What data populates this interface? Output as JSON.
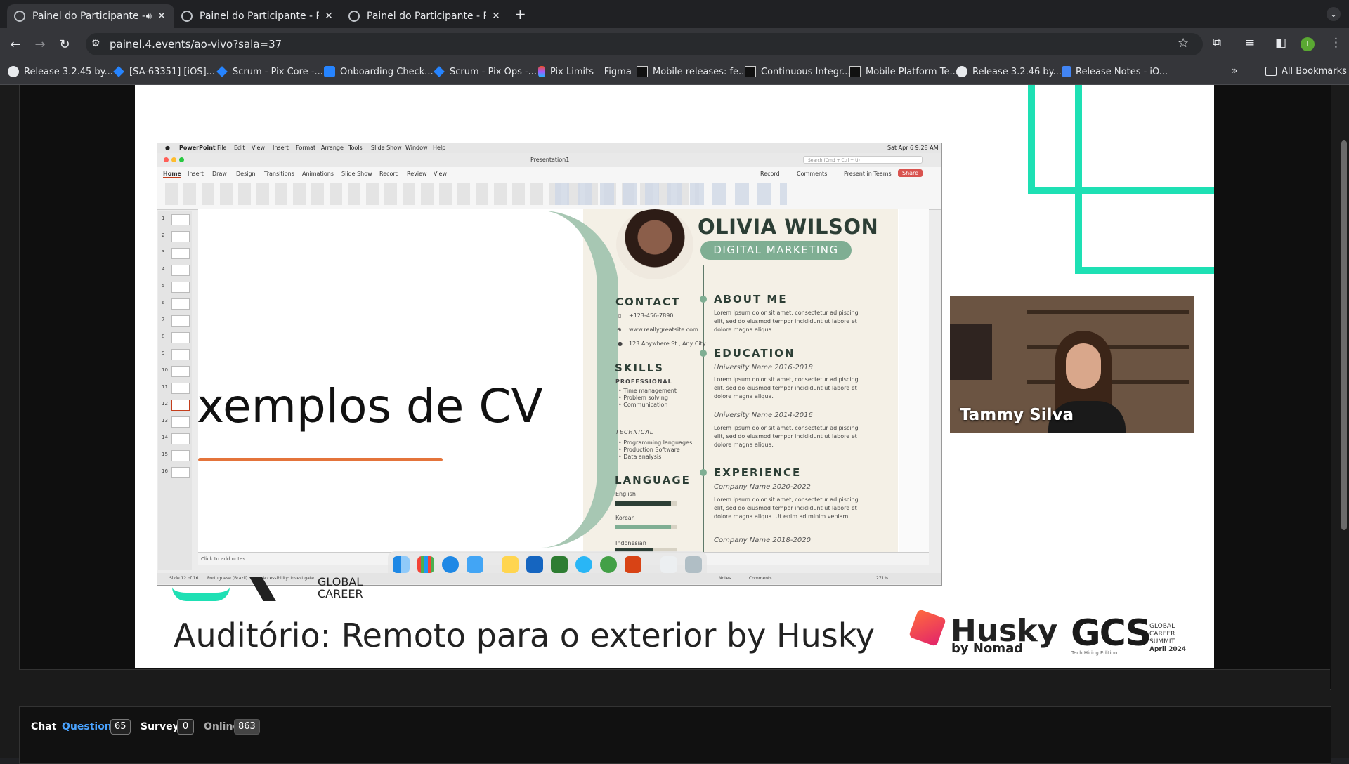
{
  "browser": {
    "tabs": [
      {
        "title": "Painel do Participante - P",
        "active": true,
        "muted_icon": "speaker-icon"
      },
      {
        "title": "Painel do Participante - Powe",
        "active": false
      },
      {
        "title": "Painel do Participante - Powe",
        "active": false
      }
    ],
    "new_tab_label": "+",
    "url": "painel.4.events/ao-vivo?sala=37",
    "profile_initial": "I",
    "bookmarks": [
      {
        "label": "Release 3.2.45 by...",
        "icon": "github-icon"
      },
      {
        "label": "[SA-63351] [iOS]...",
        "icon": "jira-icon"
      },
      {
        "label": "Scrum - Pix Core -...",
        "icon": "jira-icon"
      },
      {
        "label": "Onboarding Check...",
        "icon": "confluence-icon"
      },
      {
        "label": "Scrum - Pix Ops -...",
        "icon": "jira-icon"
      },
      {
        "label": "Pix Limits – Figma",
        "icon": "figma-icon"
      },
      {
        "label": "Mobile releases: fe...",
        "icon": "ci-icon"
      },
      {
        "label": "Continuous Integr...",
        "icon": "ci-icon"
      },
      {
        "label": "Mobile Platform Te...",
        "icon": "ci-icon"
      },
      {
        "label": "Release 3.2.46 by...",
        "icon": "github-icon"
      },
      {
        "label": "Release Notes - iO...",
        "icon": "docs-icon"
      }
    ],
    "all_bookmarks": "All Bookmarks"
  },
  "shared_screen": {
    "mac_menu": [
      "PowerPoint",
      "File",
      "Edit",
      "View",
      "Insert",
      "Format",
      "Arrange",
      "Tools",
      "Slide Show",
      "Window",
      "Help"
    ],
    "clock": "Sat Apr 6  9:28 AM",
    "doc_title": "Presentation1",
    "search_placeholder": "Search (Cmd + Ctrl + U)",
    "ribbon_tabs": [
      "Home",
      "Insert",
      "Draw",
      "Design",
      "Transitions",
      "Animations",
      "Slide Show",
      "Record",
      "Review",
      "View"
    ],
    "ribbon_actions": [
      "Record",
      "Comments",
      "Present in Teams",
      "Share"
    ],
    "slide_numbers": [
      "1",
      "2",
      "3",
      "4",
      "5",
      "6",
      "7",
      "8",
      "9",
      "10",
      "11",
      "12",
      "13",
      "14",
      "15",
      "16"
    ],
    "slide_heading": "xemplos de CV",
    "notes_placeholder": "Click to add notes",
    "status_left": "Slide 12 of 16",
    "status_lang": "Portuguese (Brazil)",
    "status_access": "Accessibility: Investigate",
    "status_notes": "Notes",
    "status_comments": "Comments",
    "zoom": "271%",
    "resume": {
      "name": "OLIVIA WILSON",
      "role": "DIGITAL MARKETING",
      "contact_title": "CONTACT",
      "phone": "+123-456-7890",
      "website": "www.reallygreatsite.com",
      "address": "123 Anywhere St., Any City",
      "skills_title": "SKILLS",
      "professional_title": "PROFESSIONAL",
      "professional_items": [
        "• Time management",
        "• Problem solving",
        "• Communication"
      ],
      "technical_title": "TECHNICAL",
      "technical_items": [
        "• Programming languages",
        "• Production Software",
        "• Data analysis"
      ],
      "language_title": "LANGUAGE",
      "languages": [
        {
          "name": "English",
          "level": 0.9
        },
        {
          "name": "Korean",
          "level": 0.9
        },
        {
          "name": "Indonesian",
          "level": 0.6
        }
      ],
      "about_title": "ABOUT ME",
      "lorem": "Lorem ipsum dolor sit amet, consectetur adipiscing elit, sed do eiusmod tempor incididunt ut labore et dolore magna aliqua.",
      "lorem_long": "Lorem ipsum dolor sit amet, consectetur adipiscing elit, sed do eiusmod tempor incididunt ut labore et dolore magna aliqua. Ut enim ad minim veniam.",
      "education_title": "EDUCATION",
      "edu1": "University Name 2016-2018",
      "edu2": "University Name 2014-2016",
      "experience_title": "EXPERIENCE",
      "exp1": "Company Name 2020-2022",
      "exp2": "Company Name 2018-2020"
    }
  },
  "camera": {
    "name": "Tammy Silva"
  },
  "lower_third": {
    "global_career": "GLOBAL\nCAREER",
    "title": "Auditório: Remoto para o exterior by Husky",
    "husky": "Husky",
    "husky_sub": "by Nomad",
    "gcs": "GCS",
    "gcs_sub_1": "GLOBAL",
    "gcs_sub_2": "CAREER",
    "gcs_sub_3": "SUMMIT",
    "gcs_sub_4": "April 2024",
    "gcs_edition": "Tech Hiring Edition"
  },
  "panel": {
    "tabs": [
      {
        "label": "Chat",
        "count": null
      },
      {
        "label": "Questions",
        "count": "65"
      },
      {
        "label": "Surveys",
        "count": "0"
      },
      {
        "label": "Online",
        "count": "863"
      }
    ]
  },
  "colors": {
    "accent_teal": "#1ee0b4",
    "questions_blue": "#4aa3ff",
    "resume_green": "#7fae93"
  }
}
